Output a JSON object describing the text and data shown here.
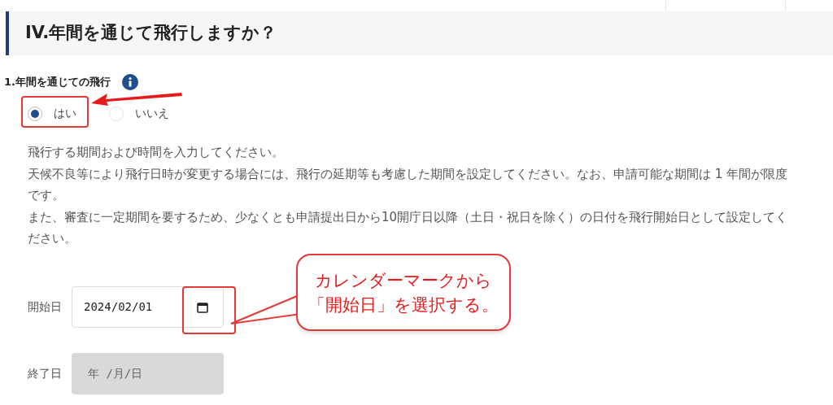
{
  "section_title": "IV.年間を通じて飛行しますか？",
  "question": {
    "label": "1.年間を通じての飛行",
    "options": [
      {
        "label": "はい",
        "selected": true
      },
      {
        "label": "いいえ",
        "selected": false
      }
    ]
  },
  "instructions": [
    "飛行する期間および時間を入力してください。",
    "天候不良等により飛行日時が変更する場合には、飛行の延期等も考慮した期間を設定してください。なお、申請可能な期間は 1 年間が限度です。",
    "また、審査に一定期間を要するため、少なくとも申請提出日から10開庁日以降（土日・祝日を除く）の日付を飛行開始日として設定してください。"
  ],
  "date_fields": [
    {
      "label": "開始日",
      "value": "2024/02/01",
      "disabled": false
    },
    {
      "label": "終了日",
      "placeholder": "年 /月/日",
      "disabled": true
    }
  ],
  "callout": {
    "lines": [
      "カレンダーマークから",
      "「開始日」を選択する。"
    ]
  }
}
